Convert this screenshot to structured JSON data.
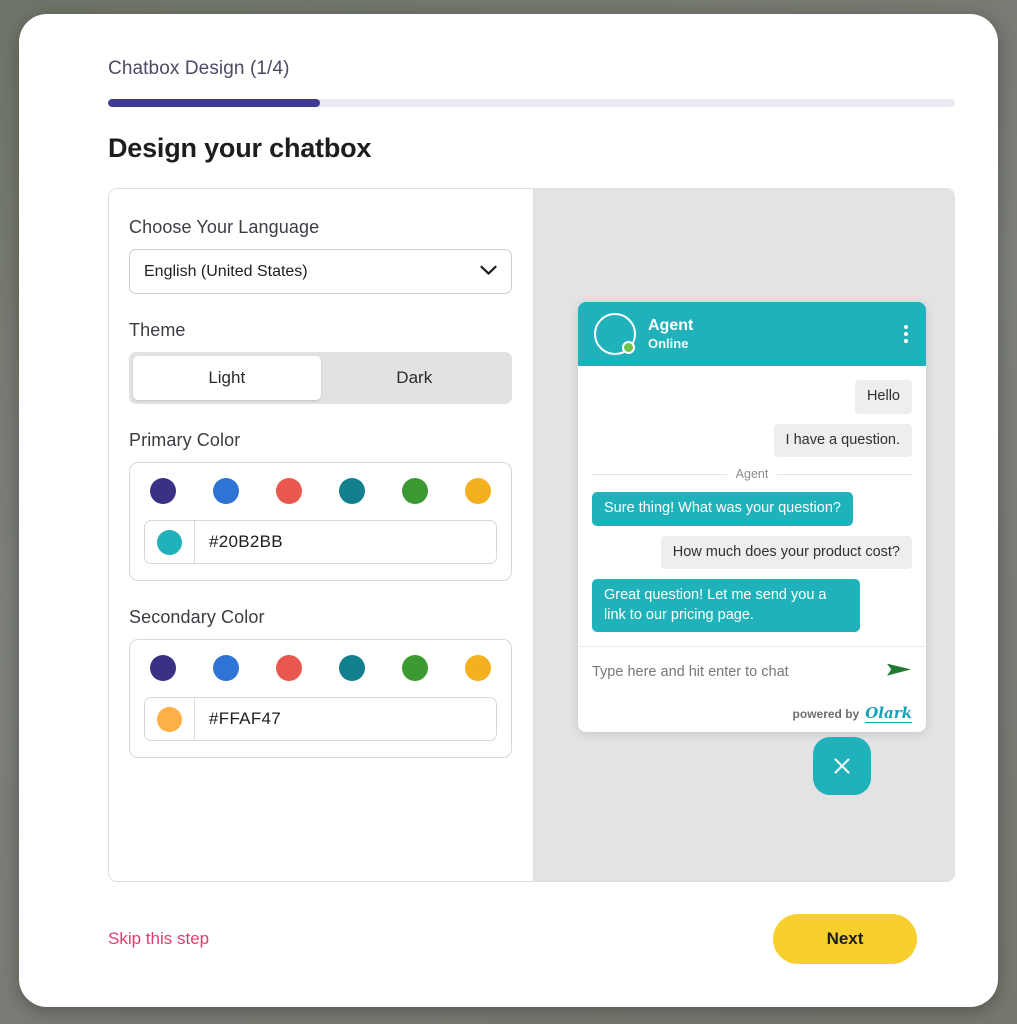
{
  "header": {
    "step_label": "Chatbox Design (1/4)",
    "progress_percent": 25,
    "page_title": "Design your chatbox",
    "progress_color": "#3f3a93"
  },
  "form": {
    "language": {
      "label": "Choose Your Language",
      "value": "English (United States)",
      "chevron_icon": "chevron-down-icon"
    },
    "theme": {
      "label": "Theme",
      "options": [
        "Light",
        "Dark"
      ],
      "selected": "Light"
    },
    "primary_color": {
      "label": "Primary Color",
      "swatches": [
        "#3b3184",
        "#2f73d4",
        "#e8584f",
        "#12808c",
        "#3c9a32",
        "#f5b01f"
      ],
      "value": "#20B2BB"
    },
    "secondary_color": {
      "label": "Secondary Color",
      "swatches": [
        "#3b3184",
        "#2f73d4",
        "#e8584f",
        "#12808c",
        "#3c9a32",
        "#f5b01f"
      ],
      "value": "#FFAF47"
    }
  },
  "preview": {
    "background": "#e3e3e3",
    "widget": {
      "agent_name": "Agent",
      "agent_status": "Online",
      "online_dot_color": "#6cc24a",
      "menu_icon": "kebab-menu-icon",
      "avatar_icon": "agent-avatar-icon",
      "messages": [
        {
          "sender": "visitor",
          "text": "Hello"
        },
        {
          "sender": "visitor",
          "text": "I have a question."
        },
        {
          "sender": "divider",
          "text": "Agent"
        },
        {
          "sender": "agent",
          "text": "Sure thing! What was your question?"
        },
        {
          "sender": "visitor",
          "text": "How much does your product cost?"
        },
        {
          "sender": "agent",
          "text": "Great question! Let me send you a link to our pricing page."
        }
      ],
      "input_placeholder": "Type here and hit enter to chat",
      "send_icon": "send-arrow-icon",
      "send_icon_color": "#1f7a33",
      "powered_by_text": "powered by",
      "brand_name": "Olark"
    },
    "close_button": {
      "icon": "close-icon",
      "color": "#20b2bb"
    }
  },
  "footer": {
    "skip_label": "Skip this step",
    "next_label": "Next",
    "next_color": "#f7cf2e",
    "skip_color": "#e23b6d"
  }
}
